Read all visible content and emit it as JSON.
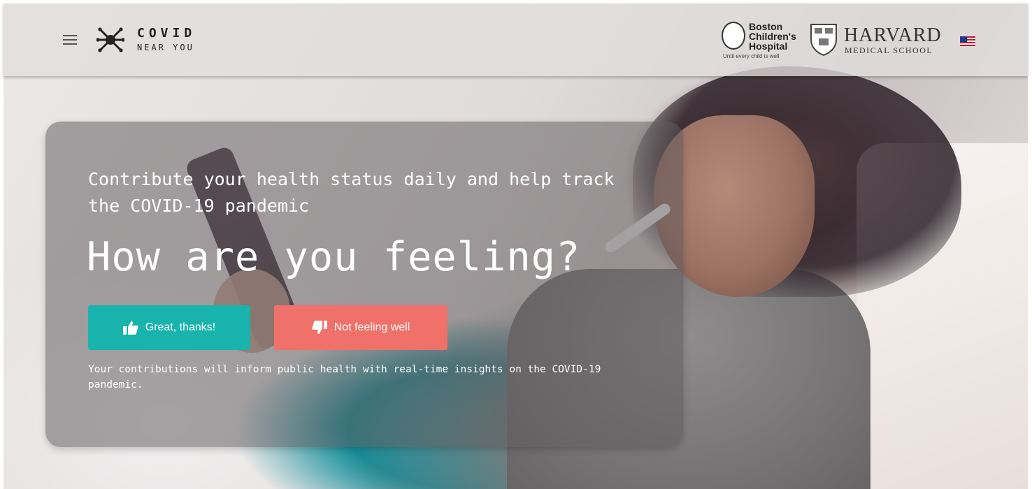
{
  "header": {
    "logo": {
      "main": "COVID",
      "sub": "NEAR YOU"
    },
    "partners": {
      "boston_childrens": {
        "line1": "Boston",
        "line2": "Children's",
        "line3": "Hospital",
        "tagline": "Until every child is well"
      },
      "harvard": {
        "name": "HARVARD",
        "sub": "MEDICAL SCHOOL"
      }
    },
    "icons": {
      "menu": "hamburger-menu-icon",
      "logo": "virus-icon",
      "language": "us-flag-icon"
    }
  },
  "hero": {
    "subhead": "Contribute your health status daily and help track the COVID-19 pandemic",
    "headline": "How are you feeling?",
    "buttons": {
      "good": {
        "label": "Great, thanks!",
        "icon": "thumbs-up-icon",
        "color": "#19b3ad"
      },
      "bad": {
        "label": "Not feeling well",
        "icon": "thumbs-down-icon",
        "color": "#f0706a"
      }
    },
    "disclaimer": "Your contributions will inform public health with real-time insights on the COVID-19 pandemic."
  }
}
